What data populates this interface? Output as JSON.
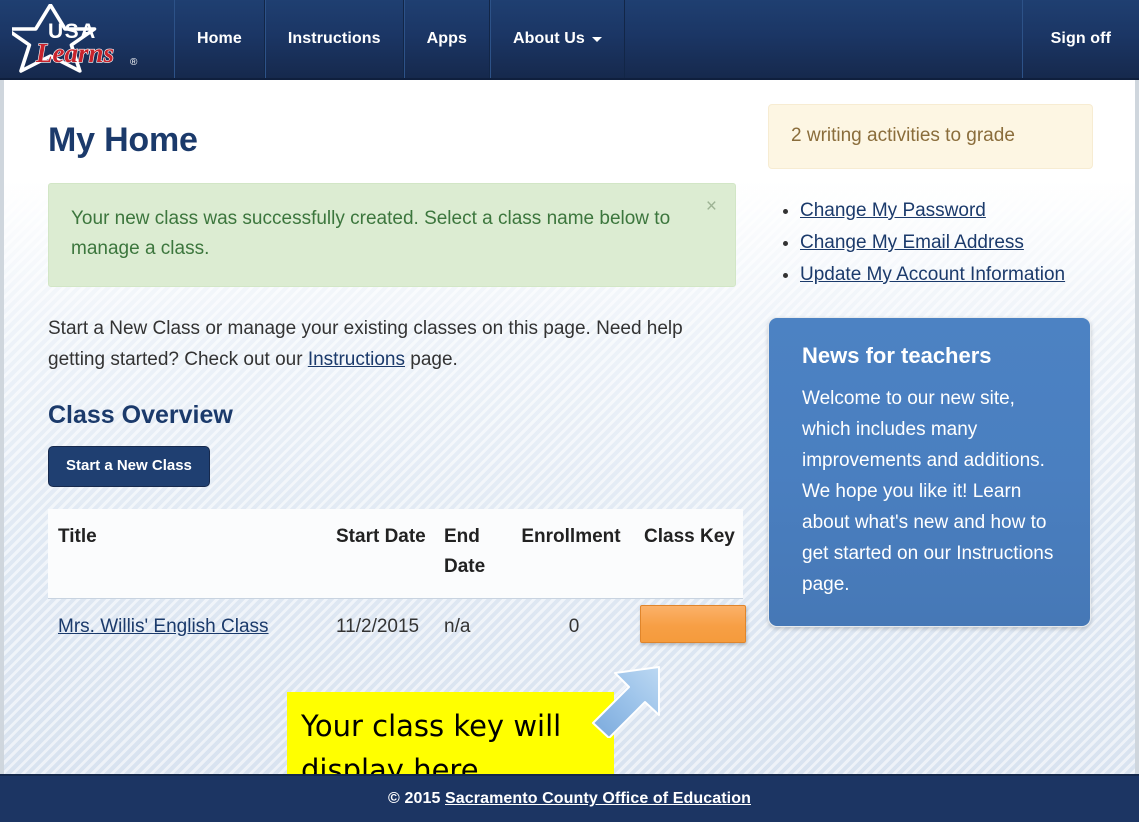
{
  "navbar": {
    "logo": {
      "top_text": "USA",
      "script_text": "Learns",
      "trademark": "®",
      "icon": "star-logo-icon"
    },
    "items": [
      {
        "label": "Home",
        "name": "nav-item-home",
        "caret": false
      },
      {
        "label": "Instructions",
        "name": "nav-item-instructions",
        "caret": false
      },
      {
        "label": "Apps",
        "name": "nav-item-apps",
        "caret": false
      },
      {
        "label": "About Us",
        "name": "nav-item-about-us",
        "caret": true
      }
    ],
    "signoff_label": "Sign off"
  },
  "main": {
    "page_title": "My Home",
    "alert": {
      "message": "Your new class was successfully created. Select a class name below to manage a class.",
      "close_label": "×"
    },
    "intro": {
      "part1": "Start a New Class or manage your existing classes on this page. Need help getting started? Check out our ",
      "link": "Instructions",
      "part2": " page."
    },
    "section_title": "Class Overview",
    "new_class_button": "Start a New Class",
    "table": {
      "headers": [
        "Title",
        "Start Date",
        "End Date",
        "Enrollment",
        "Class Key"
      ],
      "rows": [
        {
          "title": "Mrs. Willis' English Class",
          "start_date": "11/2/2015",
          "end_date": "n/a",
          "enrollment": "0",
          "class_key": ""
        }
      ]
    },
    "annotation": {
      "callout_line1": "Your class key will",
      "callout_line2": "display here.",
      "arrow": "arrow-up-right-icon"
    }
  },
  "sidebar": {
    "grading_alert": "2 writing activities to grade",
    "links": [
      "Change My Password",
      "Change My Email Address",
      "Update My Account Information"
    ],
    "news": {
      "title": "News for teachers",
      "body": "Welcome to our new site, which includes many improvements and additions. We hope you like it! Learn about what's new and how to get started on our Instructions page."
    }
  },
  "footer": {
    "copyright": "© 2015 ",
    "org_link": "Sacramento County Office of Education"
  },
  "colors": {
    "navy": "#1f3f71",
    "footer_navy": "#1c3563",
    "success_green_bg": "#dcecd2",
    "success_green_text": "#3c763d",
    "warning_cream_bg": "#fdf6e3",
    "warning_text": "#8a6d3b",
    "news_blue": "#4a7fc0",
    "class_key_orange": "#f79f45",
    "callout_yellow": "#ffff00",
    "arrow_blue": "#7fb0e0",
    "link_navy": "#1b3a6b"
  }
}
